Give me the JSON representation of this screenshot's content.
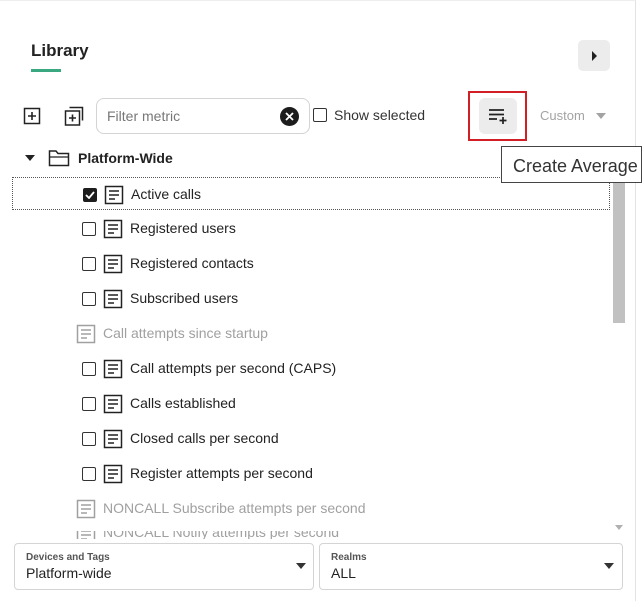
{
  "library": {
    "title": "Library"
  },
  "toolbar": {
    "filter_placeholder": "Filter metric",
    "show_selected_label": "Show selected",
    "custom_label": "Custom",
    "tooltip": "Create Average"
  },
  "tree": {
    "folder_label": "Platform-Wide",
    "items": [
      {
        "label": "Active calls",
        "checked": true,
        "enabled": true
      },
      {
        "label": "Registered users",
        "checked": false,
        "enabled": true
      },
      {
        "label": "Registered contacts",
        "checked": false,
        "enabled": true
      },
      {
        "label": "Subscribed users",
        "checked": false,
        "enabled": true
      },
      {
        "label": "Call attempts since startup",
        "enabled": false
      },
      {
        "label": "Call attempts per second (CAPS)",
        "checked": false,
        "enabled": true
      },
      {
        "label": "Calls established",
        "checked": false,
        "enabled": true
      },
      {
        "label": "Closed calls per second",
        "checked": false,
        "enabled": true
      },
      {
        "label": "Register attempts per second",
        "checked": false,
        "enabled": true
      },
      {
        "label": "NONCALL Subscribe attempts per second",
        "enabled": false
      },
      {
        "label": "NONCALL Notify attempts per second",
        "enabled": false
      }
    ]
  },
  "filters": {
    "devices_label": "Devices and Tags",
    "devices_value": "Platform-wide",
    "realms_label": "Realms",
    "realms_value": "ALL"
  },
  "colors": {
    "accent": "#3aa981",
    "highlight": "#d21f26"
  }
}
